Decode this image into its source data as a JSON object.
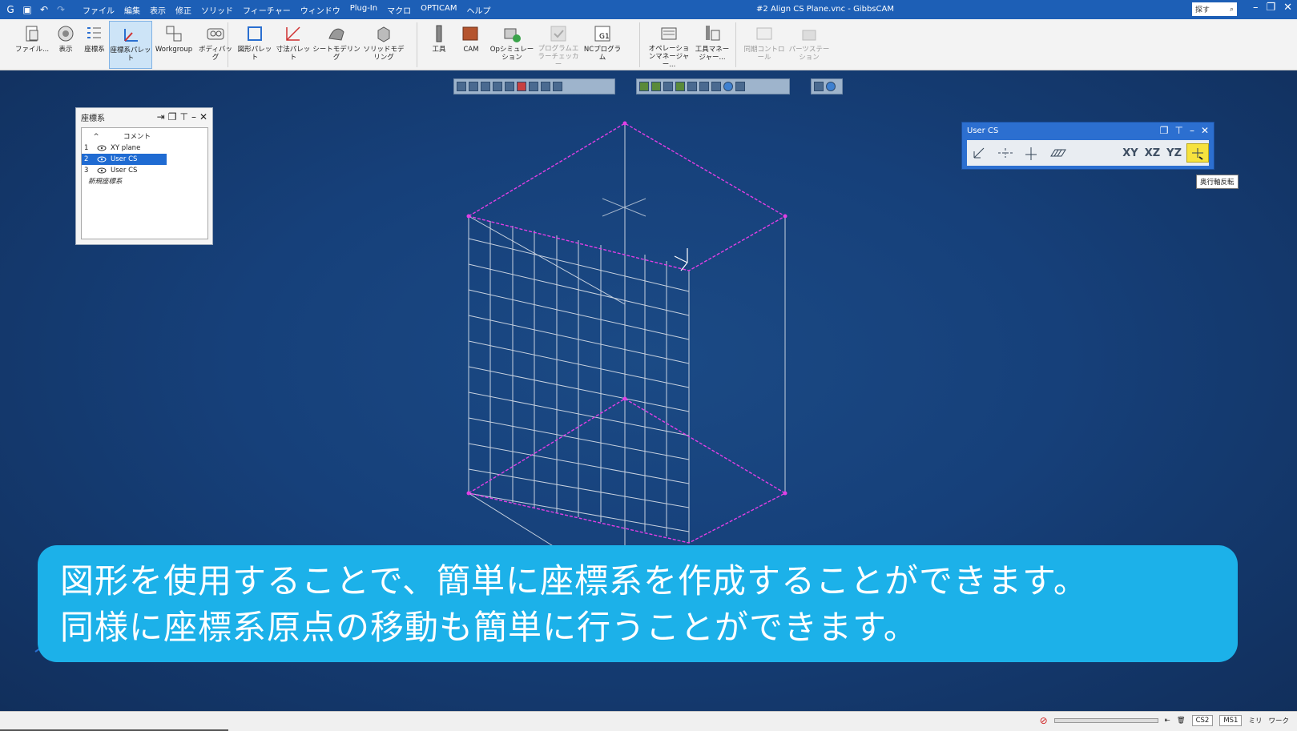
{
  "window": {
    "title": "#2 Align CS Plane.vnc - GibbsCAM",
    "search_label": "探す",
    "menu": [
      "ファイル",
      "編集",
      "表示",
      "修正",
      "ソリッド",
      "フィーチャー",
      "ウィンドウ",
      "Plug-In",
      "マクロ",
      "OPTICAM",
      "ヘルプ"
    ]
  },
  "ribbon": {
    "group1": [
      "ファイル...",
      "表示",
      "座標系",
      "座標系パレット",
      "Workgroup",
      "ボディバッグ"
    ],
    "group2": [
      "図形パレット",
      "寸法パレット",
      "シートモデリング",
      "ソリッドモデリング"
    ],
    "group3": [
      "工具",
      "CAM",
      "Opシミュレーション",
      "プログラムエラーチェッカー",
      "NCプログラム"
    ],
    "group4": [
      "オペレーションマネージャー...",
      "工具マネージャー..."
    ],
    "group5": [
      "同期コントロール",
      "パーツステーション"
    ]
  },
  "cs_panel": {
    "title": "座標系",
    "column": "コメント",
    "rows": [
      {
        "num": "1",
        "name": "XY plane",
        "selected": false
      },
      {
        "num": "2",
        "name": "User CS",
        "selected": true
      },
      {
        "num": "3",
        "name": "User CS",
        "selected": false
      }
    ],
    "new_label": "新規座標系"
  },
  "user_cs_panel": {
    "title": "User CS",
    "plane_labels": [
      "XY",
      "XZ",
      "YZ"
    ],
    "tooltip": "奥行軸反転"
  },
  "caption": {
    "line1": "図形を使用することで、簡単に座標系を作成することができます。",
    "line2": "同様に座標系原点の移動も簡単に行うことができます。"
  },
  "status": {
    "cs": "CS2",
    "plane": "MS1",
    "units": "ミリ",
    "mode": "ワーク"
  },
  "colors": {
    "viewport_bg": "#16407a",
    "wire": "#c8d2e0",
    "magenta": "#e23fe6",
    "caption_bg": "#1cb1e9",
    "selection": "#1f6bd2"
  }
}
